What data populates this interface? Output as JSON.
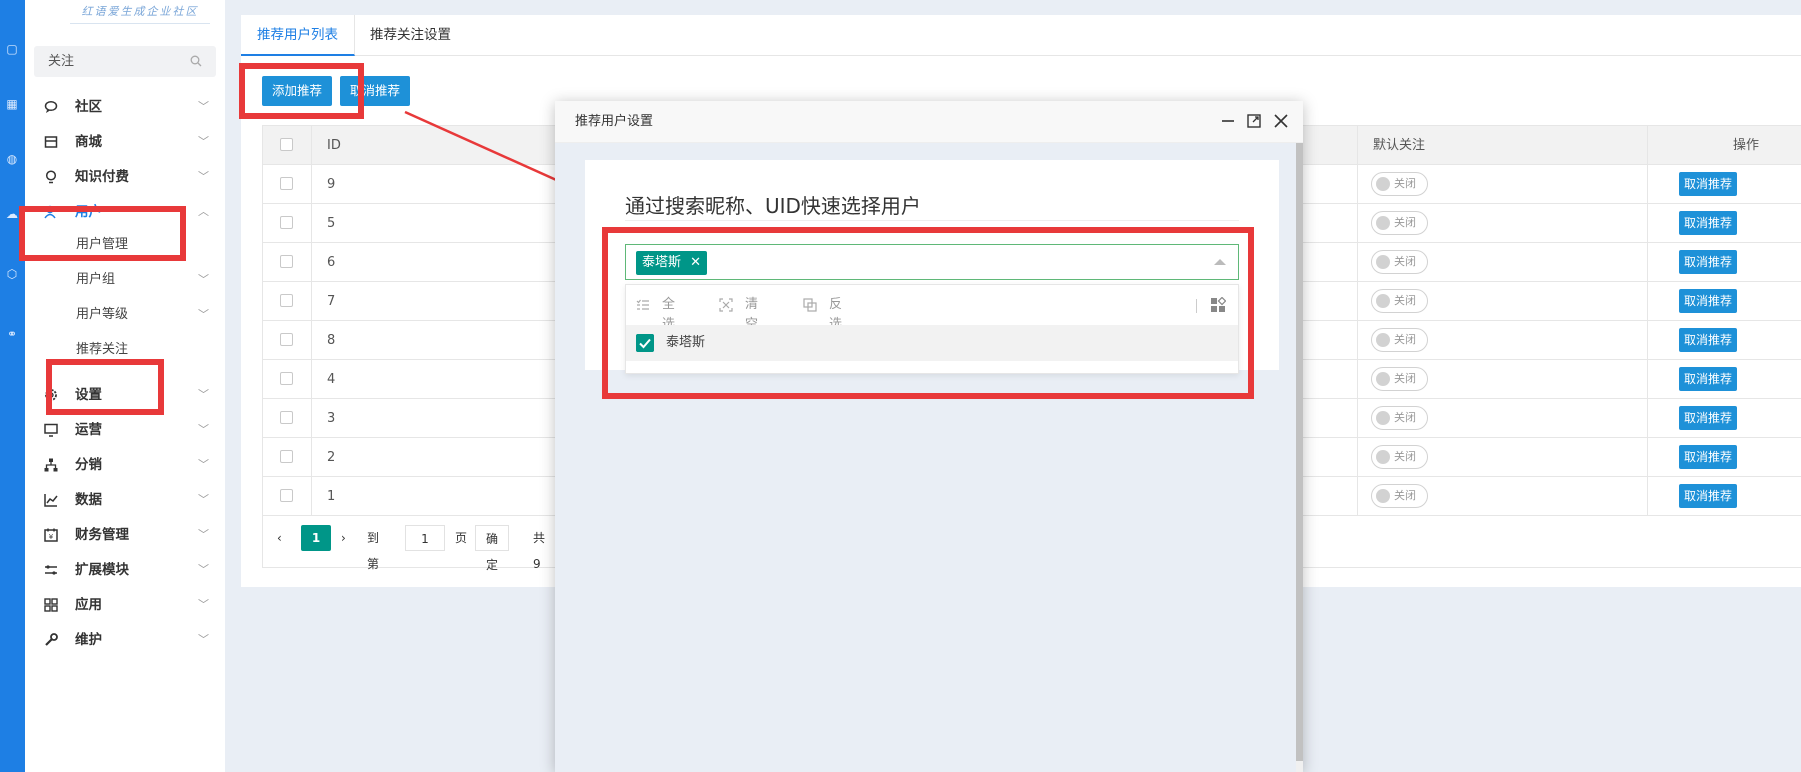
{
  "logo_text": "红语爱生成企业社区",
  "sidebar": {
    "search_text": "关注",
    "items": [
      {
        "label": "社区",
        "icon": "chat-icon"
      },
      {
        "label": "商城",
        "icon": "shop-icon"
      },
      {
        "label": "知识付费",
        "icon": "bulb-icon"
      },
      {
        "label": "用户",
        "icon": "user-icon",
        "active": true
      },
      {
        "label": "设置",
        "icon": "gear-icon"
      },
      {
        "label": "运营",
        "icon": "monitor-icon"
      },
      {
        "label": "分销",
        "icon": "tree-icon"
      },
      {
        "label": "数据",
        "icon": "chart-icon"
      },
      {
        "label": "财务管理",
        "icon": "finance-icon"
      },
      {
        "label": "扩展模块",
        "icon": "extend-icon"
      },
      {
        "label": "应用",
        "icon": "app-icon"
      },
      {
        "label": "维护",
        "icon": "wrench-icon"
      }
    ],
    "user_sub": [
      {
        "label": "用户管理"
      },
      {
        "label": "用户组"
      },
      {
        "label": "用户等级"
      },
      {
        "label": "推荐关注"
      }
    ]
  },
  "tabs": {
    "list": "推荐用户列表",
    "settings": "推荐关注设置"
  },
  "toolbar": {
    "add": "添加推荐",
    "cancel": "取消推荐"
  },
  "table": {
    "headers": {
      "id": "ID",
      "default_follow": "默认关注",
      "action": "操作"
    },
    "rows": [
      {
        "id": "9"
      },
      {
        "id": "5"
      },
      {
        "id": "6"
      },
      {
        "id": "7"
      },
      {
        "id": "8"
      },
      {
        "id": "4"
      },
      {
        "id": "3"
      },
      {
        "id": "2"
      },
      {
        "id": "1"
      }
    ],
    "switch_label": "关闭",
    "row_action": "取消推荐"
  },
  "pager": {
    "current": "1",
    "goto": "到第",
    "page_input": "1",
    "page_unit": "页",
    "confirm": "确定",
    "total": "共 9"
  },
  "modal": {
    "title": "推荐用户设置",
    "panel_title": "通过搜索昵称、UID快速选择用户",
    "chip": "泰塔斯",
    "tools": {
      "select_all": "全选",
      "clear": "清空",
      "invert": "反选"
    },
    "option": "泰塔斯"
  },
  "colors": {
    "primary": "#1e7fe4",
    "button": "#1e91d8",
    "teal": "#009688",
    "annotation": "#e8393a"
  }
}
